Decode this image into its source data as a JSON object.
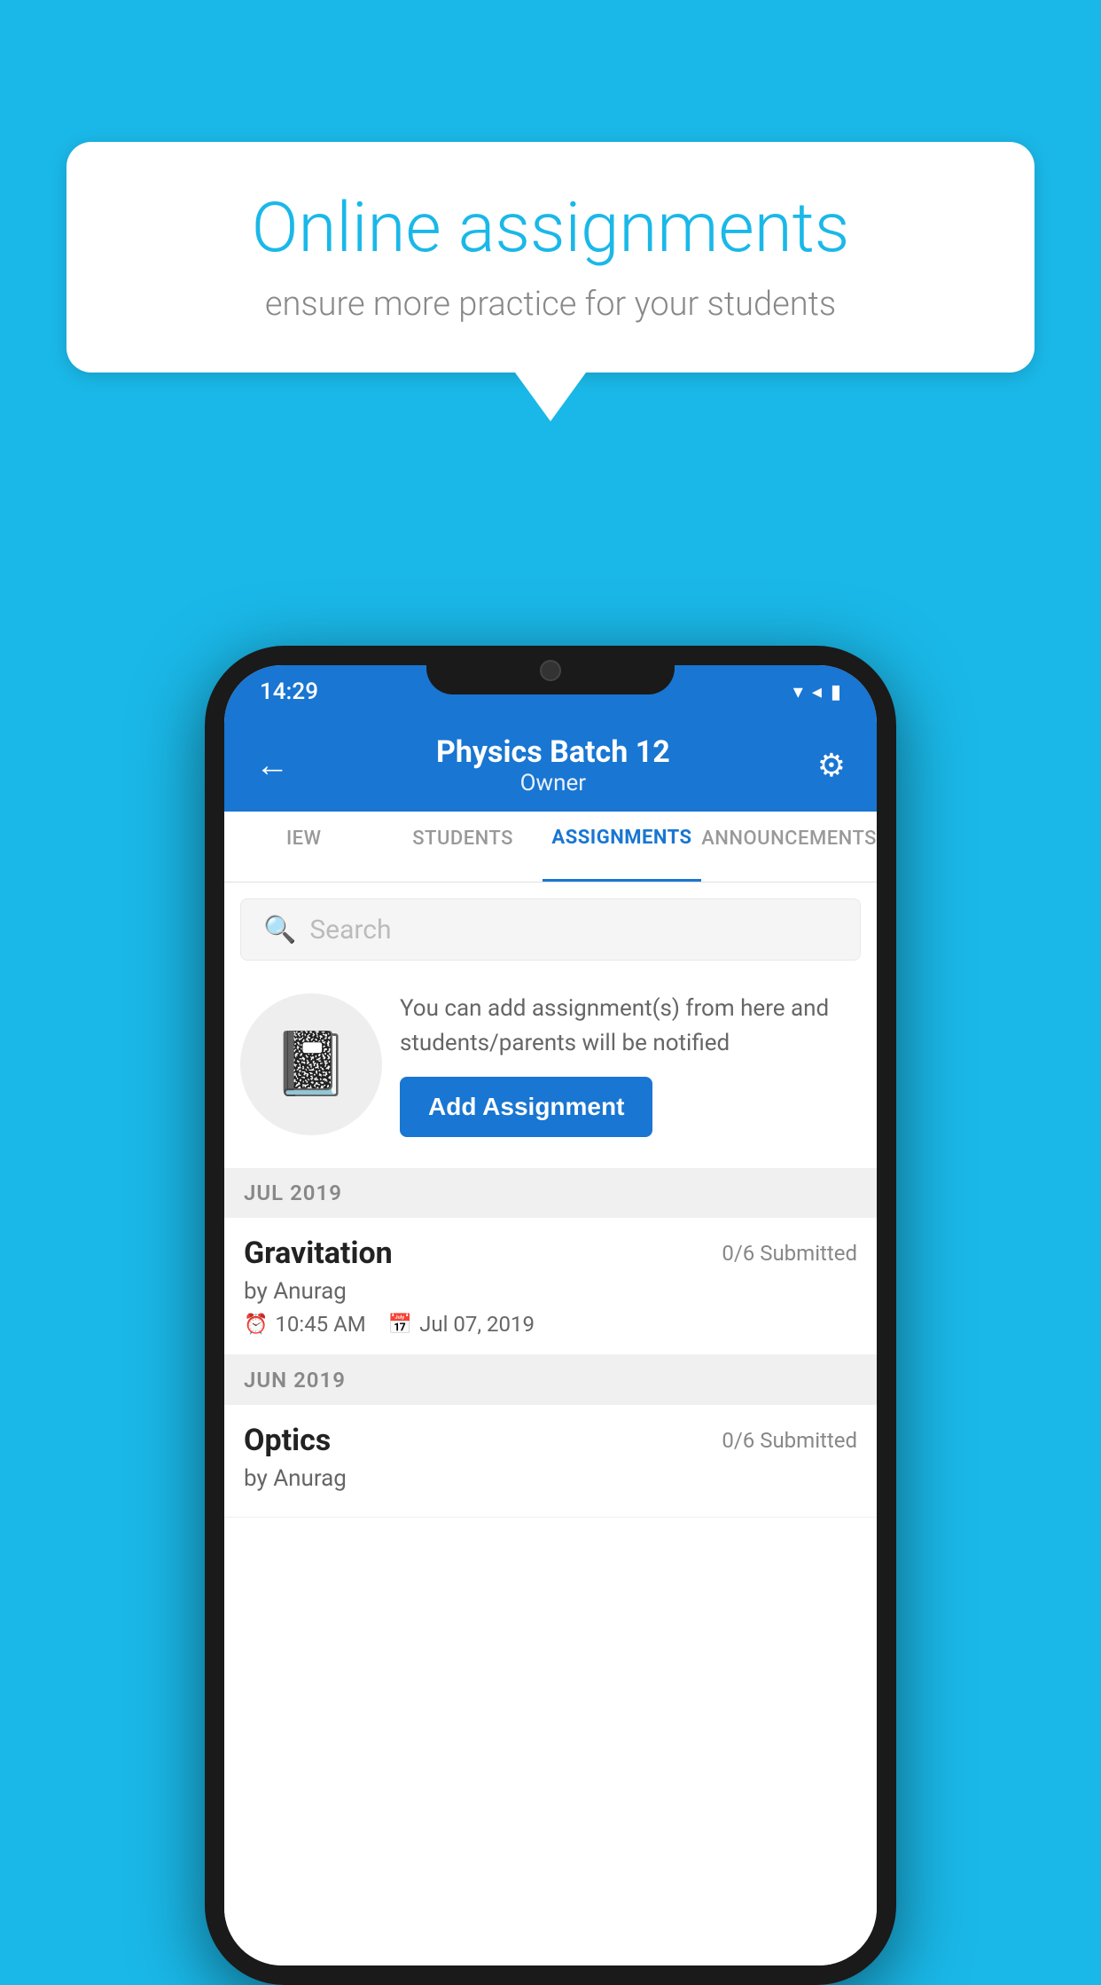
{
  "bubble": {
    "title": "Online assignments",
    "subtitle": "ensure more practice for your students"
  },
  "phone": {
    "status_bar": {
      "time": "14:29"
    },
    "header": {
      "title": "Physics Batch 12",
      "subtitle": "Owner",
      "back_label": "←",
      "settings_label": "⚙"
    },
    "tabs": [
      {
        "label": "IEW",
        "active": false
      },
      {
        "label": "STUDENTS",
        "active": false
      },
      {
        "label": "ASSIGNMENTS",
        "active": true
      },
      {
        "label": "ANNOUNCEMENTS",
        "active": false
      }
    ],
    "search": {
      "placeholder": "Search"
    },
    "promo": {
      "description": "You can add assignment(s) from here and students/parents will be notified",
      "button_label": "Add Assignment"
    },
    "sections": [
      {
        "label": "JUL 2019",
        "assignments": [
          {
            "name": "Gravitation",
            "submitted": "0/6 Submitted",
            "by": "by Anurag",
            "time": "10:45 AM",
            "date": "Jul 07, 2019"
          }
        ]
      },
      {
        "label": "JUN 2019",
        "assignments": [
          {
            "name": "Optics",
            "submitted": "0/6 Submitted",
            "by": "by Anurag",
            "time": "",
            "date": ""
          }
        ]
      }
    ]
  },
  "colors": {
    "primary": "#1976d2",
    "background": "#1ab8e8",
    "section_bg": "#f0f0f0"
  }
}
